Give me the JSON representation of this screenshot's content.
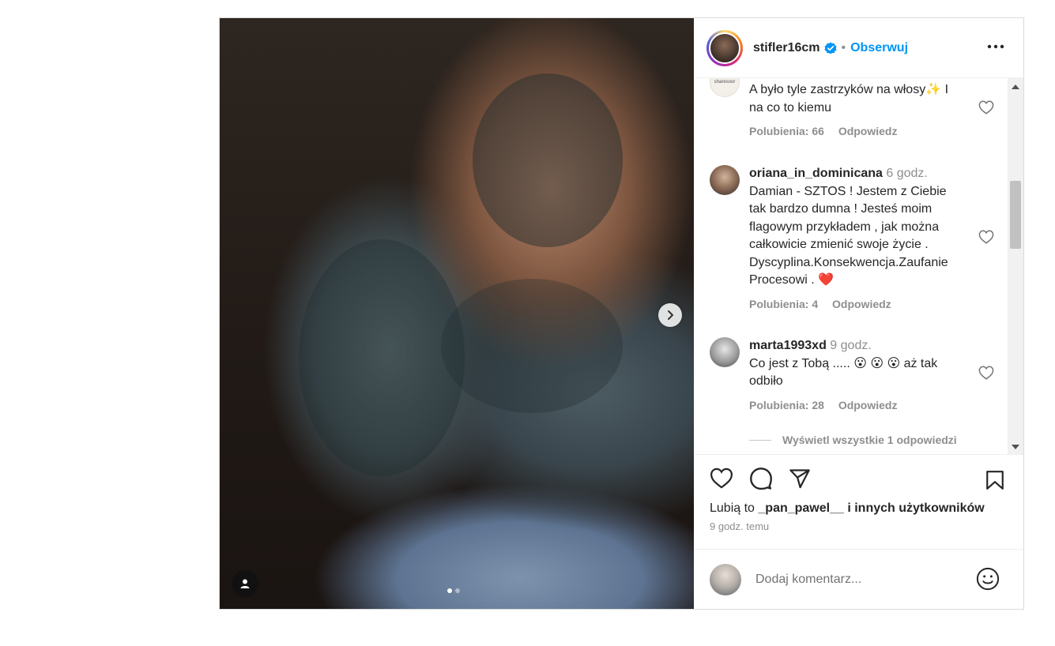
{
  "post": {
    "username": "stifler16cm",
    "follow_label": "Obserwuj",
    "separator": "•",
    "carousel_dots": 2,
    "carousel_active_index": 0
  },
  "comments": [
    {
      "username": "",
      "time": "",
      "avatar_label": "sharesoor",
      "text": "A było tyle zastrzyków na włosy✨ I na co to kiemu",
      "likes": "Polubienia: 66",
      "reply": "Odpowiedz"
    },
    {
      "username": "oriana_in_dominicana",
      "time": "6 godz.",
      "text": "Damian - SZTOS ! Jestem z Ciebie tak bardzo dumna ! Jesteś moim flagowym przykładem , jak można całkowicie zmienić swoje życie . Dyscyplina.Konsekwencja.Zaufanie Procesowi . ❤️",
      "likes": "Polubienia: 4",
      "reply": "Odpowiedz"
    },
    {
      "username": "marta1993xd",
      "time": "9 godz.",
      "text": "Co jest z Tobą ..... 😮 😮 😮  aż tak odbiło",
      "likes": "Polubienia: 28",
      "reply": "Odpowiedz"
    }
  ],
  "view_replies": "Wyświetl wszystkie 1 odpowiedzi",
  "liked_by": {
    "prefix": "Lubią to ",
    "user": "_pan_pawel__",
    "suffix": " i innych użytkowników"
  },
  "time_ago": "9 godz. temu",
  "add_comment": {
    "placeholder": "Dodaj komentarz..."
  },
  "icons": {
    "like": "heart-icon",
    "comment": "comment-bubble-icon",
    "share": "paper-plane-icon",
    "save": "bookmark-icon",
    "more": "more-dots-icon",
    "emoji": "smiley-icon",
    "next": "chevron-right-icon",
    "tags": "person-icon",
    "verified": "verified-badge-icon"
  },
  "colors": {
    "accent": "#0095f6",
    "secondary_text": "#8e8e8e"
  }
}
